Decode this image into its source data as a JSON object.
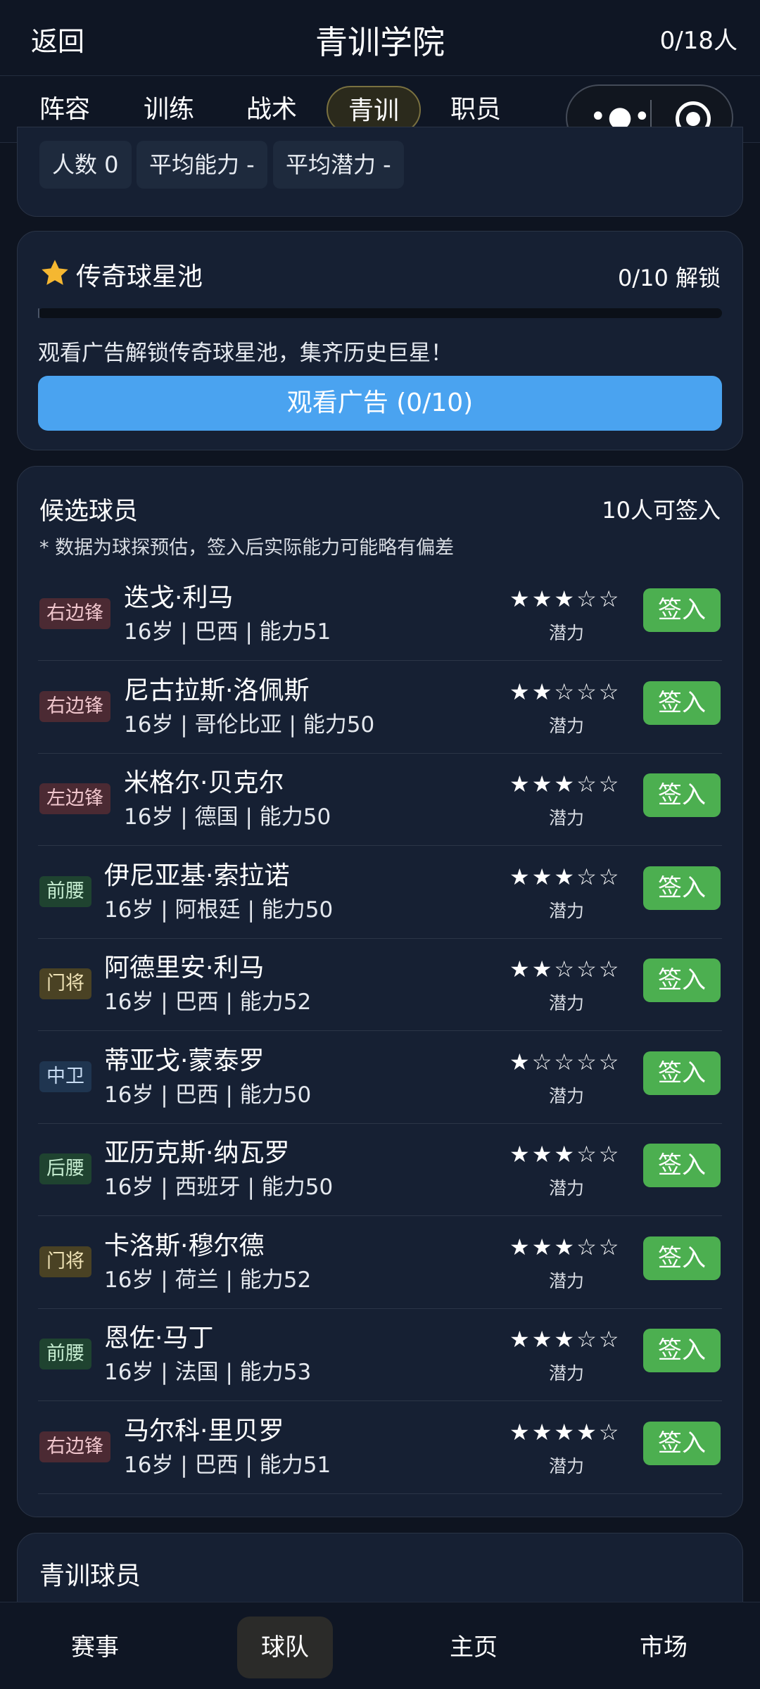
{
  "header": {
    "back": "返回",
    "title": "青训学院",
    "count": "0/18人"
  },
  "tabs": [
    {
      "label": "阵容"
    },
    {
      "label": "训练"
    },
    {
      "label": "战术"
    },
    {
      "label": "青训",
      "active": true
    },
    {
      "label": "职员"
    }
  ],
  "summary": {
    "count": "人数 0",
    "avg_ability": "平均能力 -",
    "avg_potential": "平均潜力 -"
  },
  "legend_pool": {
    "title": "传奇球星池",
    "progress_text": "0/10 解锁",
    "progress_fraction": 0.002,
    "description": "观看广告解锁传奇球星池，集齐历史巨星！",
    "button": "观看广告 (0/10)"
  },
  "candidates": {
    "title": "候选球员",
    "count": "10人可签入",
    "note": "* 数据为球探预估，签入后实际能力可能略有偏差",
    "potential_label": "潜力",
    "sign_label": "签入",
    "players": [
      {
        "position": "右边锋",
        "pos_type": "rw",
        "name": "迭戈·利马",
        "info": "16岁 | 巴西 | 能力51",
        "stars": "★★★☆☆"
      },
      {
        "position": "右边锋",
        "pos_type": "rw",
        "name": "尼古拉斯·洛佩斯",
        "info": "16岁 | 哥伦比亚 | 能力50",
        "stars": "★★☆☆☆"
      },
      {
        "position": "左边锋",
        "pos_type": "rw",
        "name": "米格尔·贝克尔",
        "info": "16岁 | 德国 | 能力50",
        "stars": "★★★☆☆"
      },
      {
        "position": "前腰",
        "pos_type": "cm",
        "name": "伊尼亚基·索拉诺",
        "info": "16岁 | 阿根廷 | 能力50",
        "stars": "★★★☆☆"
      },
      {
        "position": "门将",
        "pos_type": "gk",
        "name": "阿德里安·利马",
        "info": "16岁 | 巴西 | 能力52",
        "stars": "★★☆☆☆"
      },
      {
        "position": "中卫",
        "pos_type": "cb",
        "name": "蒂亚戈·蒙泰罗",
        "info": "16岁 | 巴西 | 能力50",
        "stars": "★☆☆☆☆"
      },
      {
        "position": "后腰",
        "pos_type": "cm",
        "name": "亚历克斯·纳瓦罗",
        "info": "16岁 | 西班牙 | 能力50",
        "stars": "★★★☆☆"
      },
      {
        "position": "门将",
        "pos_type": "gk",
        "name": "卡洛斯·穆尔德",
        "info": "16岁 | 荷兰 | 能力52",
        "stars": "★★★☆☆"
      },
      {
        "position": "前腰",
        "pos_type": "cm",
        "name": "恩佐·马丁",
        "info": "16岁 | 法国 | 能力53",
        "stars": "★★★☆☆"
      },
      {
        "position": "右边锋",
        "pos_type": "rw",
        "name": "马尔科·里贝罗",
        "info": "16岁 | 巴西 | 能力51",
        "stars": "★★★★☆"
      }
    ]
  },
  "youth": {
    "title": "青训球员"
  },
  "bottom_nav": [
    {
      "label": "赛事"
    },
    {
      "label": "球队",
      "active": true
    },
    {
      "label": "主页"
    },
    {
      "label": "市场"
    }
  ]
}
